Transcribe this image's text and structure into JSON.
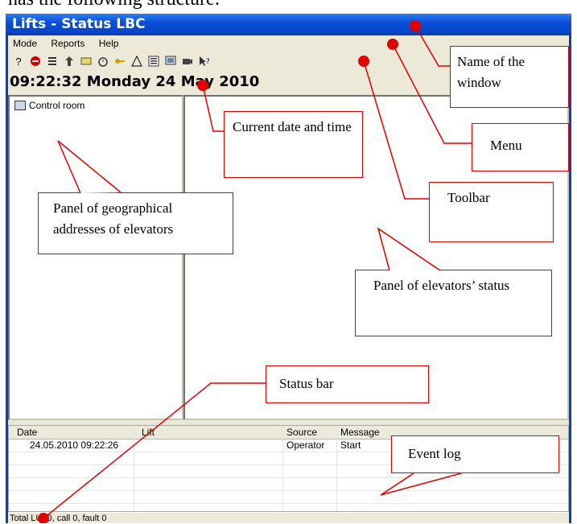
{
  "document": {
    "top_text": "has the following structure:"
  },
  "window": {
    "title": "Lifts - Status LBC"
  },
  "menu": {
    "items": [
      "Mode",
      "Reports",
      "Help"
    ]
  },
  "toolbar": {
    "buttons": [
      "help-icon",
      "stop-icon",
      "list-icon",
      "lift-icon",
      "panel-icon",
      "alarm-clock-icon",
      "key-icon",
      "warning-icon",
      "log-icon",
      "display-icon",
      "camera-icon",
      "whats-this-icon"
    ]
  },
  "clock": {
    "datetime": "09:22:32 Monday 24 May 2010"
  },
  "tree": {
    "root": "Control room"
  },
  "log": {
    "columns": [
      "Date",
      "Lift",
      "Source",
      "Message"
    ],
    "rows": [
      {
        "date": "24.05.2010 09:22:26",
        "lift": "",
        "source": "Operator",
        "message": "Start"
      }
    ]
  },
  "status": {
    "text": "Total LU: 0, call 0, fault 0"
  },
  "annotations": {
    "window_name": "Name of the window",
    "menu": "Menu",
    "toolbar": "Toolbar",
    "datetime": "Current date and time",
    "geo_panel": "Panel of geographical addresses of elevators",
    "status_panel": "Panel of elevators’ status",
    "status_bar": "Status bar",
    "event_log": "Event log"
  },
  "colors": {
    "annotation": "#e00000",
    "titlebar": "#0a4fd6"
  }
}
